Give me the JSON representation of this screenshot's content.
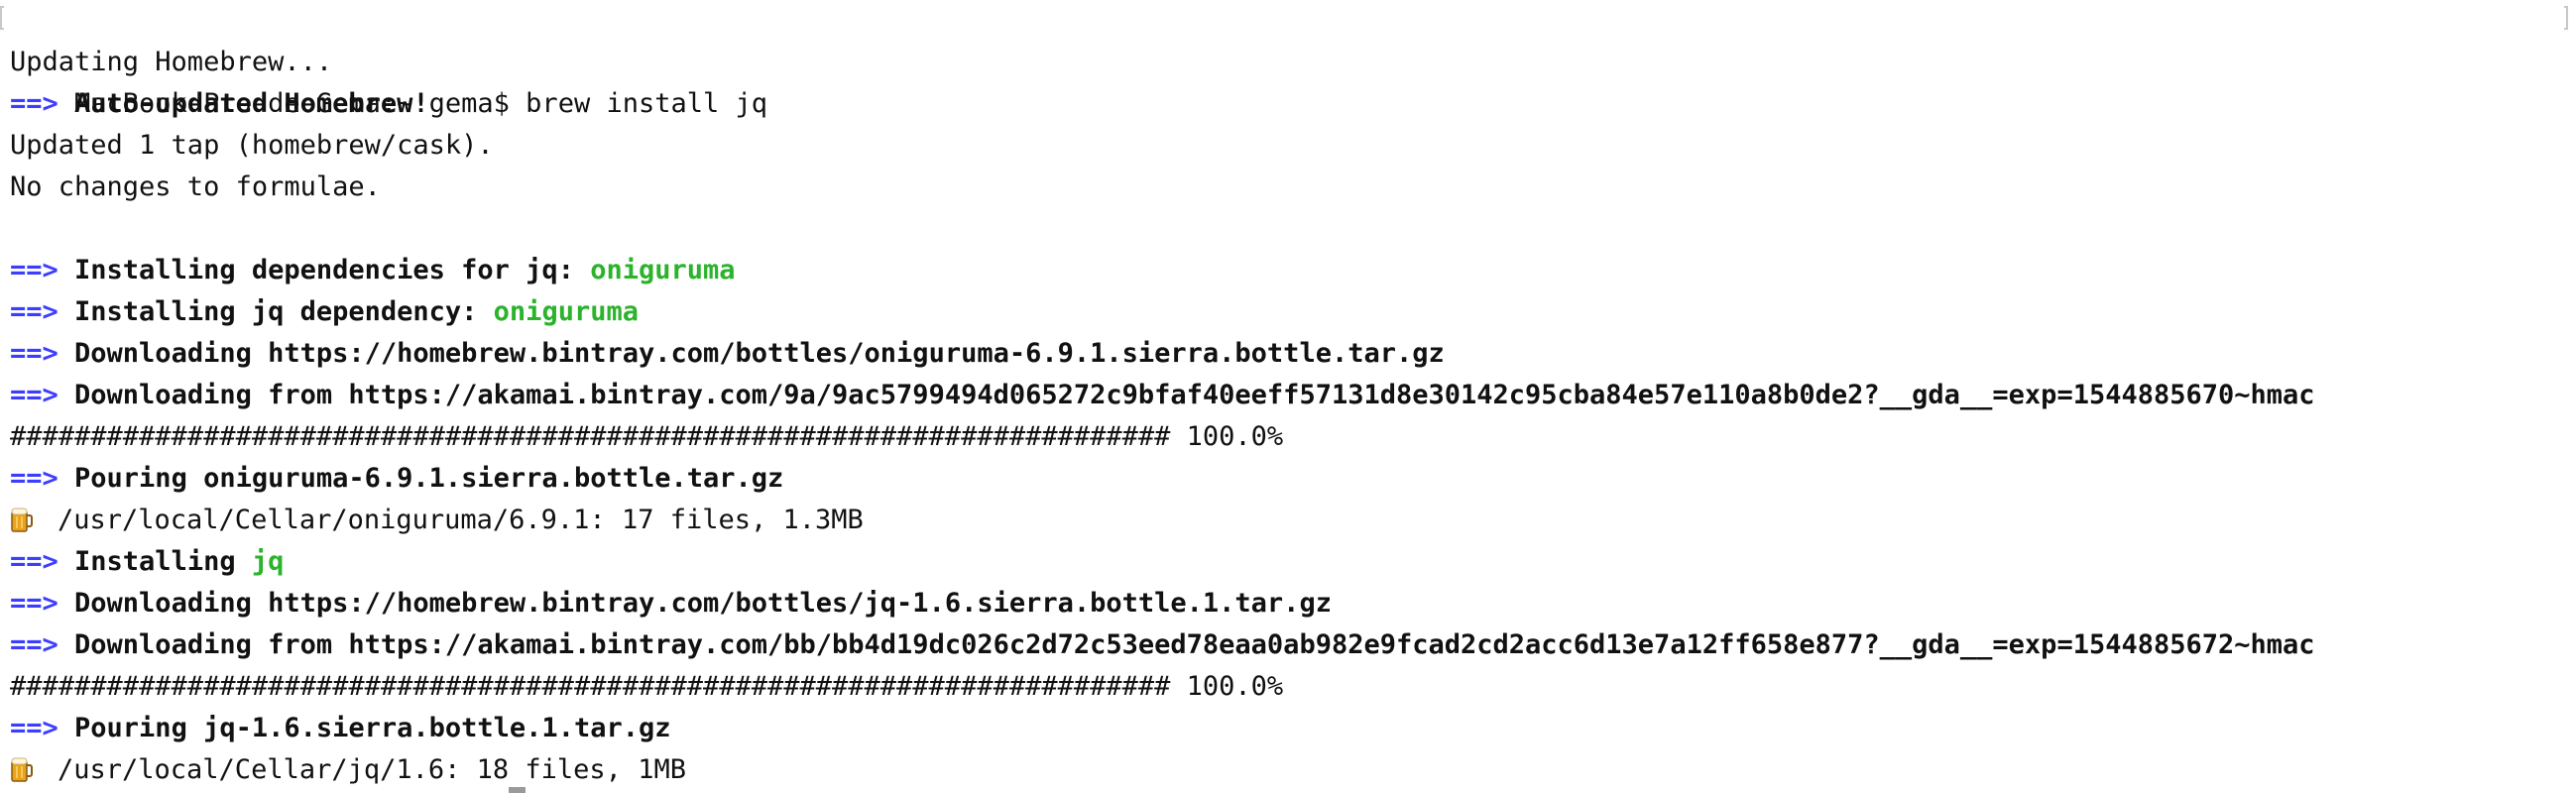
{
  "terminal": {
    "prompt": "MacBook-Pro-de-Gema:~ gema$ brew install jq",
    "updating": "Updating Homebrew...",
    "auto_updated": "Auto-updated Homebrew!",
    "updated_tap": "Updated 1 tap (homebrew/cask).",
    "no_changes": "No changes to formulae.",
    "deps_label": "Installing dependencies for jq: ",
    "deps_value": "oniguruma",
    "dep_label": "Installing jq dependency: ",
    "dep_value": "oniguruma",
    "dl1": "Downloading https://homebrew.bintray.com/bottles/oniguruma-6.9.1.sierra.bottle.tar.gz",
    "dl2": "Downloading from https://akamai.bintray.com/9a/9ac5799494d065272c9bfaf40eeff57131d8e30142c95cba84e57e110a8b0de2?__gda__=exp=1544885670~hmac",
    "progress1": "######################################################################## 100.0%",
    "pour1": "Pouring oniguruma-6.9.1.sierra.bottle.tar.gz",
    "cellar1": "/usr/local/Cellar/oniguruma/6.9.1: 17 files, 1.3MB",
    "installing_label": "Installing ",
    "installing_value": "jq",
    "dl3": "Downloading https://homebrew.bintray.com/bottles/jq-1.6.sierra.bottle.1.tar.gz",
    "dl4": "Downloading from https://akamai.bintray.com/bb/bb4d19dc026c2d72c53eed78eaa0ab982e9fcad2cd2acc6d13e7a12ff658e877?__gda__=exp=1544885672~hmac",
    "progress2": "######################################################################## 100.0%",
    "pour2": "Pouring jq-1.6.sierra.bottle.1.tar.gz",
    "cellar2": "/usr/local/Cellar/jq/1.6: 18 files, 1MB",
    "arrow": "==> "
  },
  "colors": {
    "arrow": "#3d3dff",
    "highlight": "#2bb32b",
    "text": "#111111",
    "background": "#ffffff"
  },
  "icons": {
    "beer": "beer-mug-icon"
  }
}
